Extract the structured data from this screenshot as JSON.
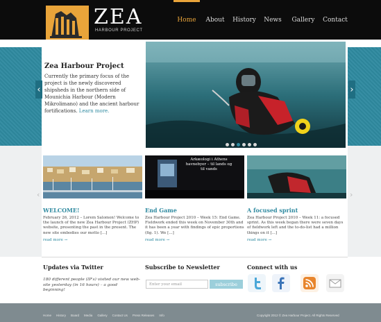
{
  "header": {
    "logo_text": "ZEA",
    "tagline": "HARBOUR PROJECT",
    "nav": [
      {
        "label": "Home",
        "active": true
      },
      {
        "label": "About",
        "active": false
      },
      {
        "label": "History",
        "active": false
      },
      {
        "label": "News",
        "active": false
      },
      {
        "label": "Gallery",
        "active": false
      },
      {
        "label": "Contact",
        "active": false
      }
    ]
  },
  "slider": {
    "title": "Zea Harbour Project",
    "text": "Currently the primary focus of the project is the newly discovered shipsheds in the northern side of Mounichia Harbour (Modern Mikrolimano) and the ancient harbour fortifications.",
    "more_label": "Learn more.",
    "slide_count": 6,
    "active_slide": 3,
    "prev_icon": "‹",
    "next_icon": "›"
  },
  "thumbs": {
    "caption_title": "Arkæologi i Athens havnebyer – til lands og til vands",
    "prev_icon": "‹",
    "next_icon": "›"
  },
  "news": [
    {
      "title": "WELCOME!",
      "text": "February 26, 2012 – Lorem Salomon! Welcome to the launch of the new Zea Harbour Project (ZHP) website, presenting the past in the present. The new site embodies our motto [...]",
      "more": "read more →"
    },
    {
      "title": "End Game",
      "text": "Zea Harbour Project 2010 – Week 15: End Game. Fieldwork ended this week on November 30th and it has been a year with findings of epic proportions (fig. 1). We [...]",
      "more": "read more →"
    },
    {
      "title": "A focused sprint",
      "text": "Zea Harbour Project 2010 – Week 11: a focused sprint. As this week began there were seven days of fieldwork left and the to-do-list had a million things on it [...]",
      "more": "read more →"
    }
  ],
  "twitter": {
    "title": "Updates via Twitter",
    "tweet": "180 different people (IP's) visited our new web-site yesterday (in 16 hours) – a good beginning!"
  },
  "newsletter": {
    "title": "Subscribe to Newsletter",
    "placeholder": "Enter your email",
    "button": "subscribe"
  },
  "connect": {
    "title": "Connect with us",
    "icons": [
      "twitter-icon",
      "facebook-icon",
      "rss-icon",
      "email-icon"
    ],
    "colors": {
      "twitter": "#4aa7d8",
      "facebook": "#3b74b8",
      "rss": "#e8852c",
      "email": "#dadada"
    }
  },
  "footer": {
    "links": [
      "Home",
      "History",
      "Board",
      "Media",
      "Gallery",
      "Contact Us",
      "Press Releases",
      "Info"
    ],
    "copyright": "Copyright 2012 © Zea Harbour Project. All Rights Reserved"
  },
  "colors": {
    "accent": "#e9a43a",
    "teal": "#2f8aa0",
    "topbar": "#0c0c0c",
    "footer": "#7f8b90"
  }
}
